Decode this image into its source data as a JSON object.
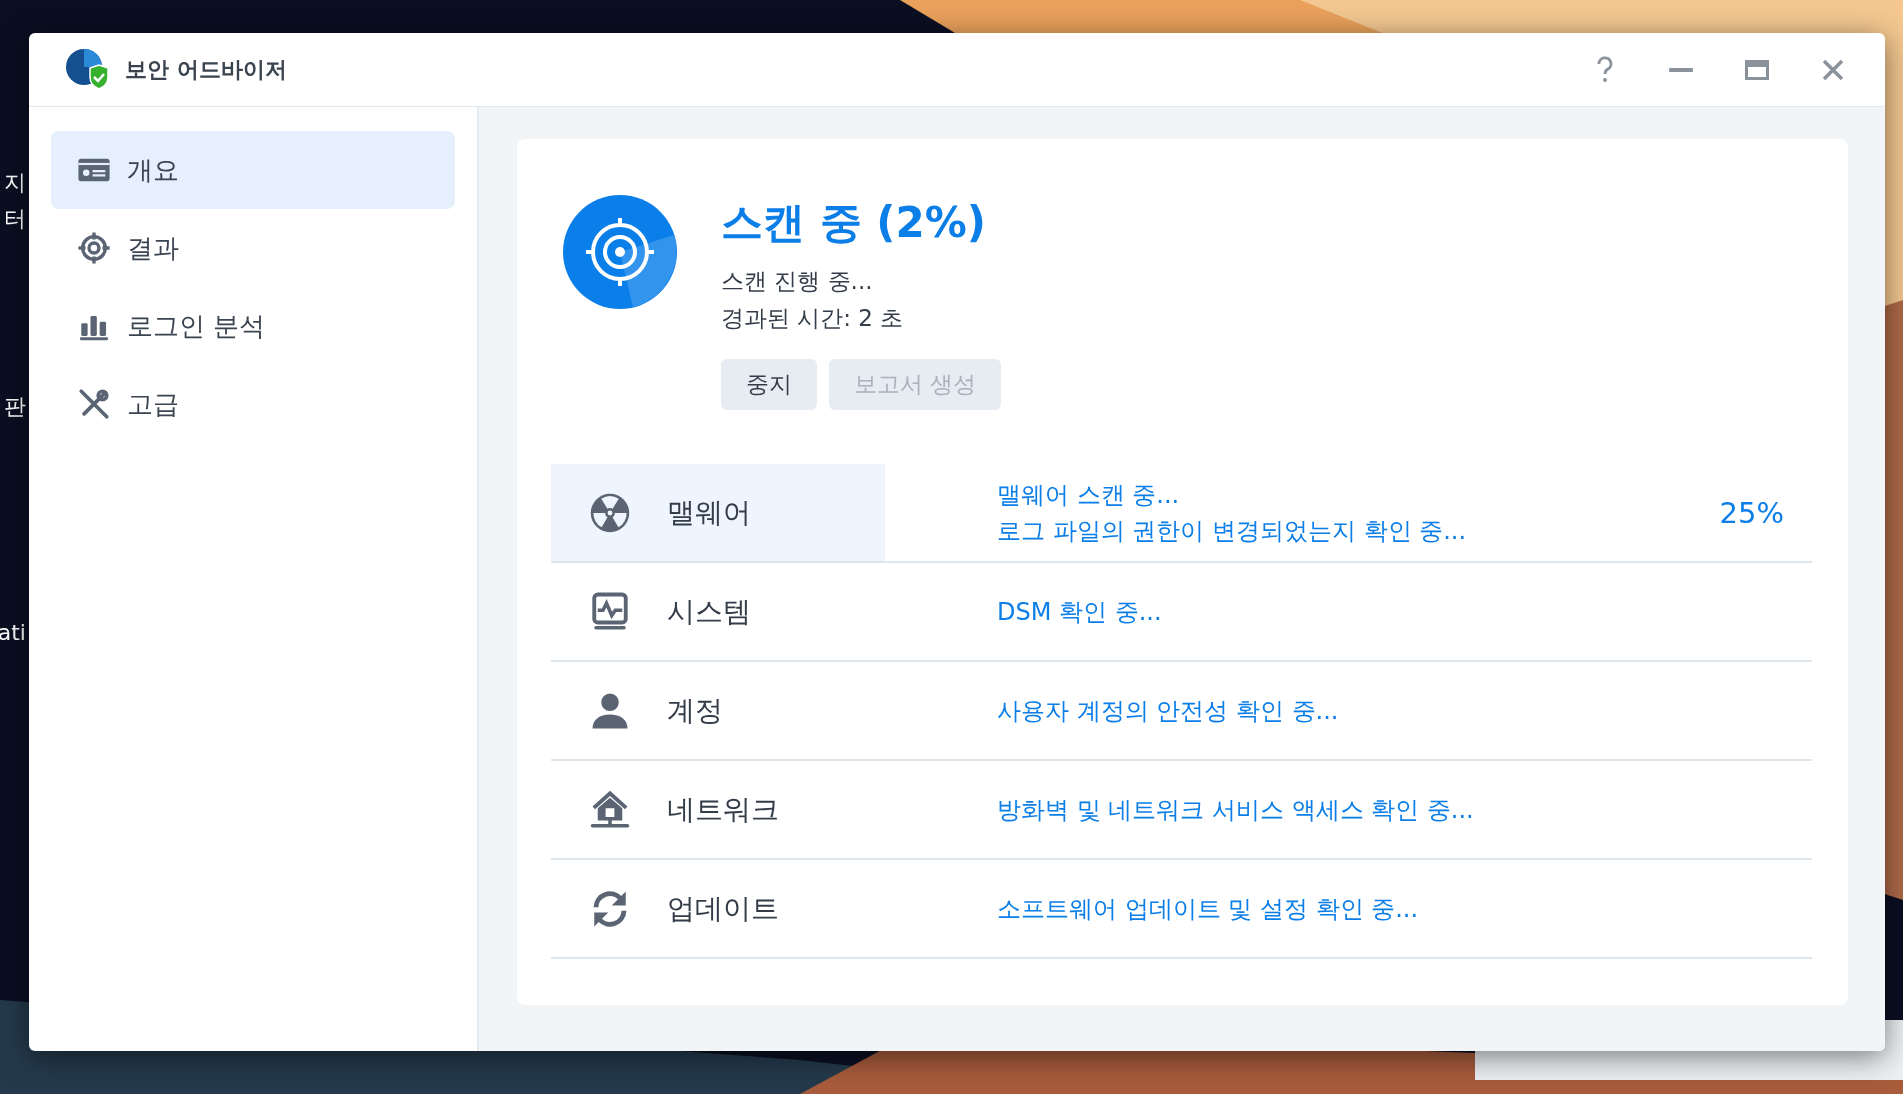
{
  "desktop": {
    "left_labels": [
      "지",
      "터",
      "판",
      "ati"
    ]
  },
  "window": {
    "title": "보안 어드바이저"
  },
  "sidebar": {
    "items": [
      {
        "label": "개요",
        "selected": true
      },
      {
        "label": "결과",
        "selected": false
      },
      {
        "label": "로그인 분석",
        "selected": false
      },
      {
        "label": "고급",
        "selected": false
      }
    ]
  },
  "status": {
    "title": "스캔 중 (2%)",
    "lines": [
      "스캔 진행 중...",
      "경과된 시간: 2 초"
    ],
    "buttons": [
      {
        "label": "중지",
        "disabled": false
      },
      {
        "label": "보고서 생성",
        "disabled": true
      }
    ]
  },
  "checks": [
    {
      "name": "맬웨어",
      "selected": true,
      "details": [
        "맬웨어 스캔 중...",
        "로그 파일의 권한이 변경되었는지 확인 중..."
      ],
      "progress": "25%"
    },
    {
      "name": "시스템",
      "selected": false,
      "details": [
        "DSM 확인 중..."
      ]
    },
    {
      "name": "계정",
      "selected": false,
      "details": [
        "사용자 계정의 안전성 확인 중..."
      ]
    },
    {
      "name": "네트워크",
      "selected": false,
      "details": [
        "방화벽 및 네트워크 서비스 액세스 확인 중..."
      ]
    },
    {
      "name": "업데이트",
      "selected": false,
      "details": [
        "소프트웨어 업데이트 및 설정 확인 중..."
      ]
    }
  ]
}
